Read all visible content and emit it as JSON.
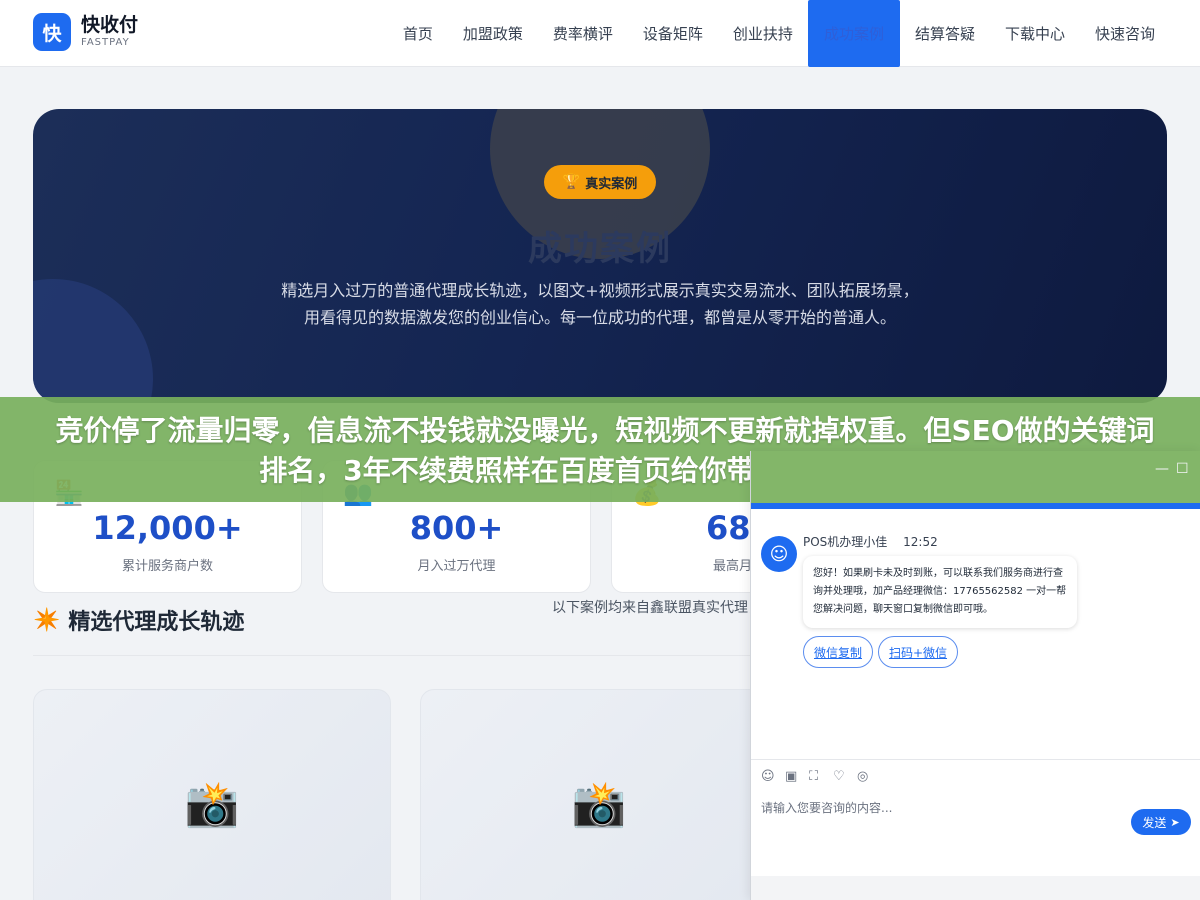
{
  "brand": {
    "logo_char": "快",
    "name": "快收付",
    "sub": "FASTPAY"
  },
  "nav": [
    {
      "label": "首页"
    },
    {
      "label": "加盟政策"
    },
    {
      "label": "费率横评"
    },
    {
      "label": "设备矩阵"
    },
    {
      "label": "创业扶持"
    },
    {
      "label": "成功案例",
      "active": true
    },
    {
      "label": "结算答疑"
    },
    {
      "label": "下载中心"
    },
    {
      "label": "快速咨询"
    }
  ],
  "hero": {
    "badge": "真实案例",
    "title": "成功案例",
    "desc": "精选月入过万的普通代理成长轨迹，以图文+视频形式展示真实交易流水、团队拓展场景，用看得见的数据激发您的创业信心。每一位成功的代理，都曾是从零开始的普通人。"
  },
  "banner": {
    "text": "竞价停了流量归零，信息流不投钱就没曝光，短视频不更新就掉权重。但SEO做的关键词排名，3年不续费照样在百度首页给你带客户，获客成本"
  },
  "stats": [
    {
      "value": "12,000+",
      "label": "累计服务商户数"
    },
    {
      "value": "800+",
      "label": "月入过万代理"
    },
    {
      "value": "68,5",
      "label": "最高月分润"
    }
  ],
  "section": {
    "title": "精选代理成长轨迹",
    "desc": "以下案例均来自鑫联盟真实代理，从零起步到月写照。"
  },
  "chat": {
    "agent": "POS机办理小佳",
    "time": "12:52",
    "message": "您好！如果刷卡未及时到账，可以联系我们服务商进行查询并处理哦，加产品经理微信：17765562582 一对一帮您解决问题，聊天窗口复制微信即可哦。",
    "buttons": [
      "微信复制",
      "扫码+微信"
    ],
    "input_placeholder": "请输入您要咨询的内容...",
    "send": "发送"
  }
}
